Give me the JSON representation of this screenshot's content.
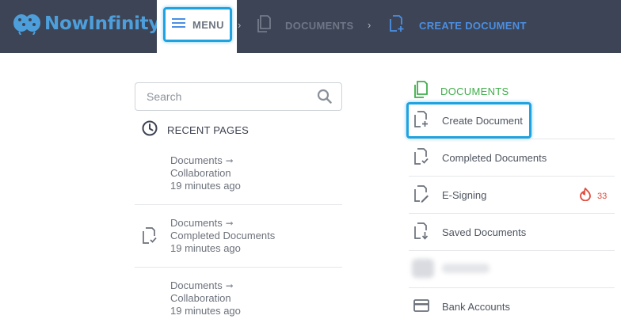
{
  "brand": {
    "name": "NowInfinity",
    "color": "#4d9fdc"
  },
  "header": {
    "menu_label": "MENU",
    "breadcrumbs": [
      {
        "label": "DOCUMENTS",
        "icon": "documents-icon"
      },
      {
        "label": "CREATE DOCUMENT",
        "icon": "create-document-icon"
      }
    ]
  },
  "search": {
    "placeholder": "Search",
    "value": ""
  },
  "recent": {
    "heading": "RECENT PAGES",
    "items": [
      {
        "line1": "Documents",
        "line2": "Collaboration",
        "time": "19 minutes ago",
        "icon": ""
      },
      {
        "line1": "Documents",
        "line2": "Completed Documents",
        "time": "19 minutes ago",
        "icon": "completed-document-icon"
      },
      {
        "line1": "Documents",
        "line2": "Collaboration",
        "time": "19 minutes ago",
        "icon": ""
      }
    ]
  },
  "documents_menu": {
    "heading": "DOCUMENTS",
    "items": [
      {
        "label": "Create Document",
        "icon": "create-document-icon"
      },
      {
        "label": "Completed Documents",
        "icon": "completed-document-icon"
      },
      {
        "label": "E-Signing",
        "icon": "e-signing-icon",
        "badge": "33"
      },
      {
        "label": "Saved Documents",
        "icon": "saved-document-icon"
      },
      {
        "label": "",
        "icon": "blurred-icon"
      },
      {
        "label": "Bank Accounts",
        "icon": "credit-card-icon"
      }
    ]
  },
  "colors": {
    "topbar": "#3d4455",
    "highlight": "#1fa3e0",
    "accent_green": "#3fae4a",
    "accent_blue": "#4a8fe3",
    "badge": "#e24b3b"
  }
}
